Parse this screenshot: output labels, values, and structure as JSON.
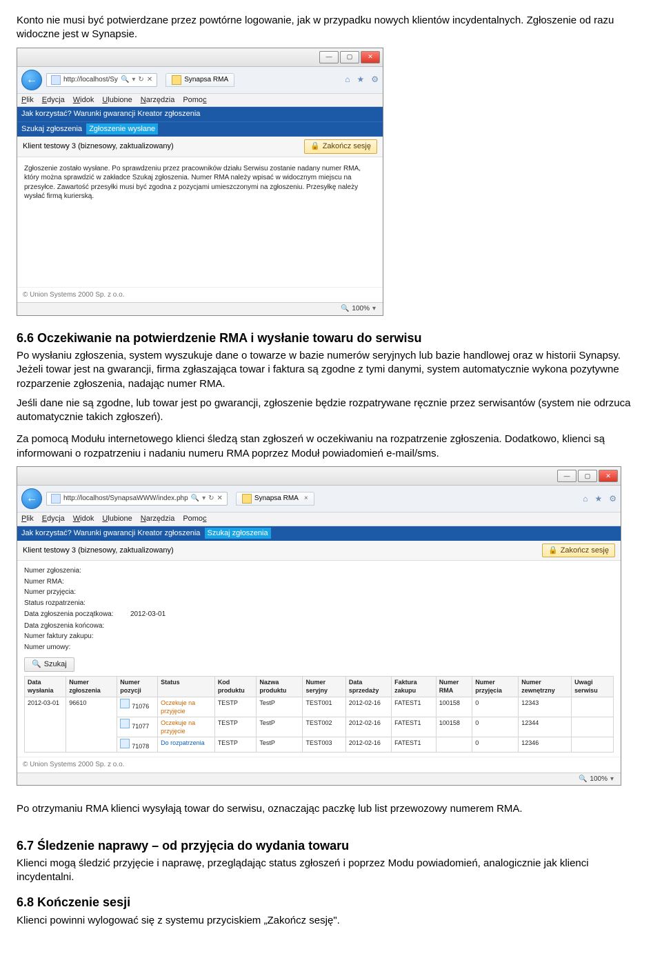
{
  "intro_para": "Konto nie musi być potwierdzane przez powtórne logowanie, jak w przypadku nowych klientów incydentalnych. Zgłoszenie od razu widoczne jest w Synapsie.",
  "section66": {
    "heading": "6.6   Oczekiwanie na potwierdzenie RMA i wysłanie towaru do serwisu",
    "p1": "Po wysłaniu zgłoszenia, system wyszukuje dane o towarze w bazie numerów seryjnych lub bazie handlowej oraz w historii Synapsy. Jeżeli towar jest na gwarancji, firma zgłaszająca towar i faktura są zgodne z tymi danymi, system automatycznie wykona pozytywne rozparzenie zgłoszenia, nadając numer RMA.",
    "p2": "Jeśli dane nie są zgodne, lub towar jest po gwarancji, zgłoszenie będzie rozpatrywane ręcznie przez serwisantów (system nie odrzuca automatycznie takich zgłoszeń).",
    "p3": "Za pomocą Modułu internetowego klienci śledzą stan zgłoszeń w oczekiwaniu na rozpatrzenie zgłoszenia. Dodatkowo, klienci są informowani o rozpatrzeniu i nadaniu numeru RMA poprzez Moduł powiadomień e-mail/sms."
  },
  "after_shot2": "Po otrzymaniu RMA klienci wysyłają towar do serwisu, oznaczając paczkę lub list przewozowy numerem RMA.",
  "section67": {
    "heading": "6.7   Śledzenie naprawy – od przyjęcia do wydania towaru",
    "p1": "Klienci mogą śledzić przyjęcie i naprawę, przeglądając status zgłoszeń i poprzez Modu powiadomień, analogicznie jak klienci incydentalni."
  },
  "section68": {
    "heading": "6.8   Kończenie sesji",
    "p1": "Klienci powinni wylogować się z systemu przyciskiem „Zakończ sesję\"."
  },
  "ie": {
    "menus": [
      "Plik",
      "Edycja",
      "Widok",
      "Ulubione",
      "Narzędzia",
      "Pomoc"
    ],
    "tab_title": "Synapsa RMA",
    "zoom": "100%"
  },
  "shot1": {
    "url": "http://localhost/Sy",
    "nav1": "Jak korzystać?  Warunki gwarancji  Kreator zgłoszenia",
    "nav2_items": [
      "Szukaj zgłoszenia",
      "Zgłoszenie wysłane"
    ],
    "nav2_active": "Zgłoszenie wysłane",
    "client": "Klient testowy 3 (biznesowy, zaktualizowany)",
    "logout": "Zakończ sesję",
    "body_text": "Zgłoszenie zostało wysłane. Po sprawdzeniu przez pracowników działu Serwisu zostanie nadany numer RMA, który można sprawdzić w zakładce Szukaj zgłoszenia. Numer RMA należy wpisać w widocznym miejscu na przesyłce. Zawartość przesyłki musi być zgodna z pozycjami umieszczonymi na zgłoszeniu. Przesyłkę należy wysłać firmą kurierską.",
    "copyright": "© Union Systems 2000 Sp. z o.o."
  },
  "shot2": {
    "url": "http://localhost/SynapsaWWW/index.php",
    "nav1": "Jak korzystać?  Warunki gwarancji  Kreator zgłoszenia",
    "nav2_active_label": "Szukaj zgłoszenia",
    "client": "Klient testowy 3 (biznesowy, zaktualizowany)",
    "logout": "Zakończ sesję",
    "form_labels": {
      "numer_zgl": "Numer zgłoszenia:",
      "numer_rma": "Numer RMA:",
      "numer_przy": "Numer przyjęcia:",
      "status": "Status rozpatrzenia:",
      "data_pocz": "Data zgłoszenia początkowa:",
      "data_konc": "Data zgłoszenia końcowa:",
      "nr_faktury": "Numer faktury zakupu:",
      "nr_umowy": "Numer umowy:"
    },
    "form_values": {
      "data_pocz": "2012-03-01"
    },
    "search_label": "Szukaj",
    "table": {
      "headers": [
        "Data wysłania",
        "Numer zgłoszenia",
        "Numer pozycji",
        "Status",
        "Kod produktu",
        "Nazwa produktu",
        "Numer seryjny",
        "Data sprzedaży",
        "Faktura zakupu",
        "Numer RMA",
        "Numer przyjęcia",
        "Numer zewnętrzny",
        "Uwagi serwisu"
      ],
      "group": {
        "data_wys": "2012-03-01",
        "numer_zgl": "96610"
      },
      "rows": [
        {
          "poz": "71076",
          "status": "Oczekuje na przyjęcie",
          "status_cls": "status-orange",
          "kod": "TESTP",
          "nazwa": "TestP",
          "ser": "TEST001",
          "data_sprz": "2012-02-16",
          "fakt": "FATEST1",
          "rma": "100158",
          "przy": "0",
          "zew": "12343",
          "uwagi": ""
        },
        {
          "poz": "71077",
          "status": "Oczekuje na przyjęcie",
          "status_cls": "status-orange",
          "kod": "TESTP",
          "nazwa": "TestP",
          "ser": "TEST002",
          "data_sprz": "2012-02-16",
          "fakt": "FATEST1",
          "rma": "100158",
          "przy": "0",
          "zew": "12344",
          "uwagi": ""
        },
        {
          "poz": "71078",
          "status": "Do rozpatrzenia",
          "status_cls": "status-blue",
          "kod": "TESTP",
          "nazwa": "TestP",
          "ser": "TEST003",
          "data_sprz": "2012-02-16",
          "fakt": "FATEST1",
          "rma": "",
          "przy": "0",
          "zew": "12346",
          "uwagi": ""
        }
      ]
    },
    "copyright": "© Union Systems 2000 Sp. z o.o."
  }
}
